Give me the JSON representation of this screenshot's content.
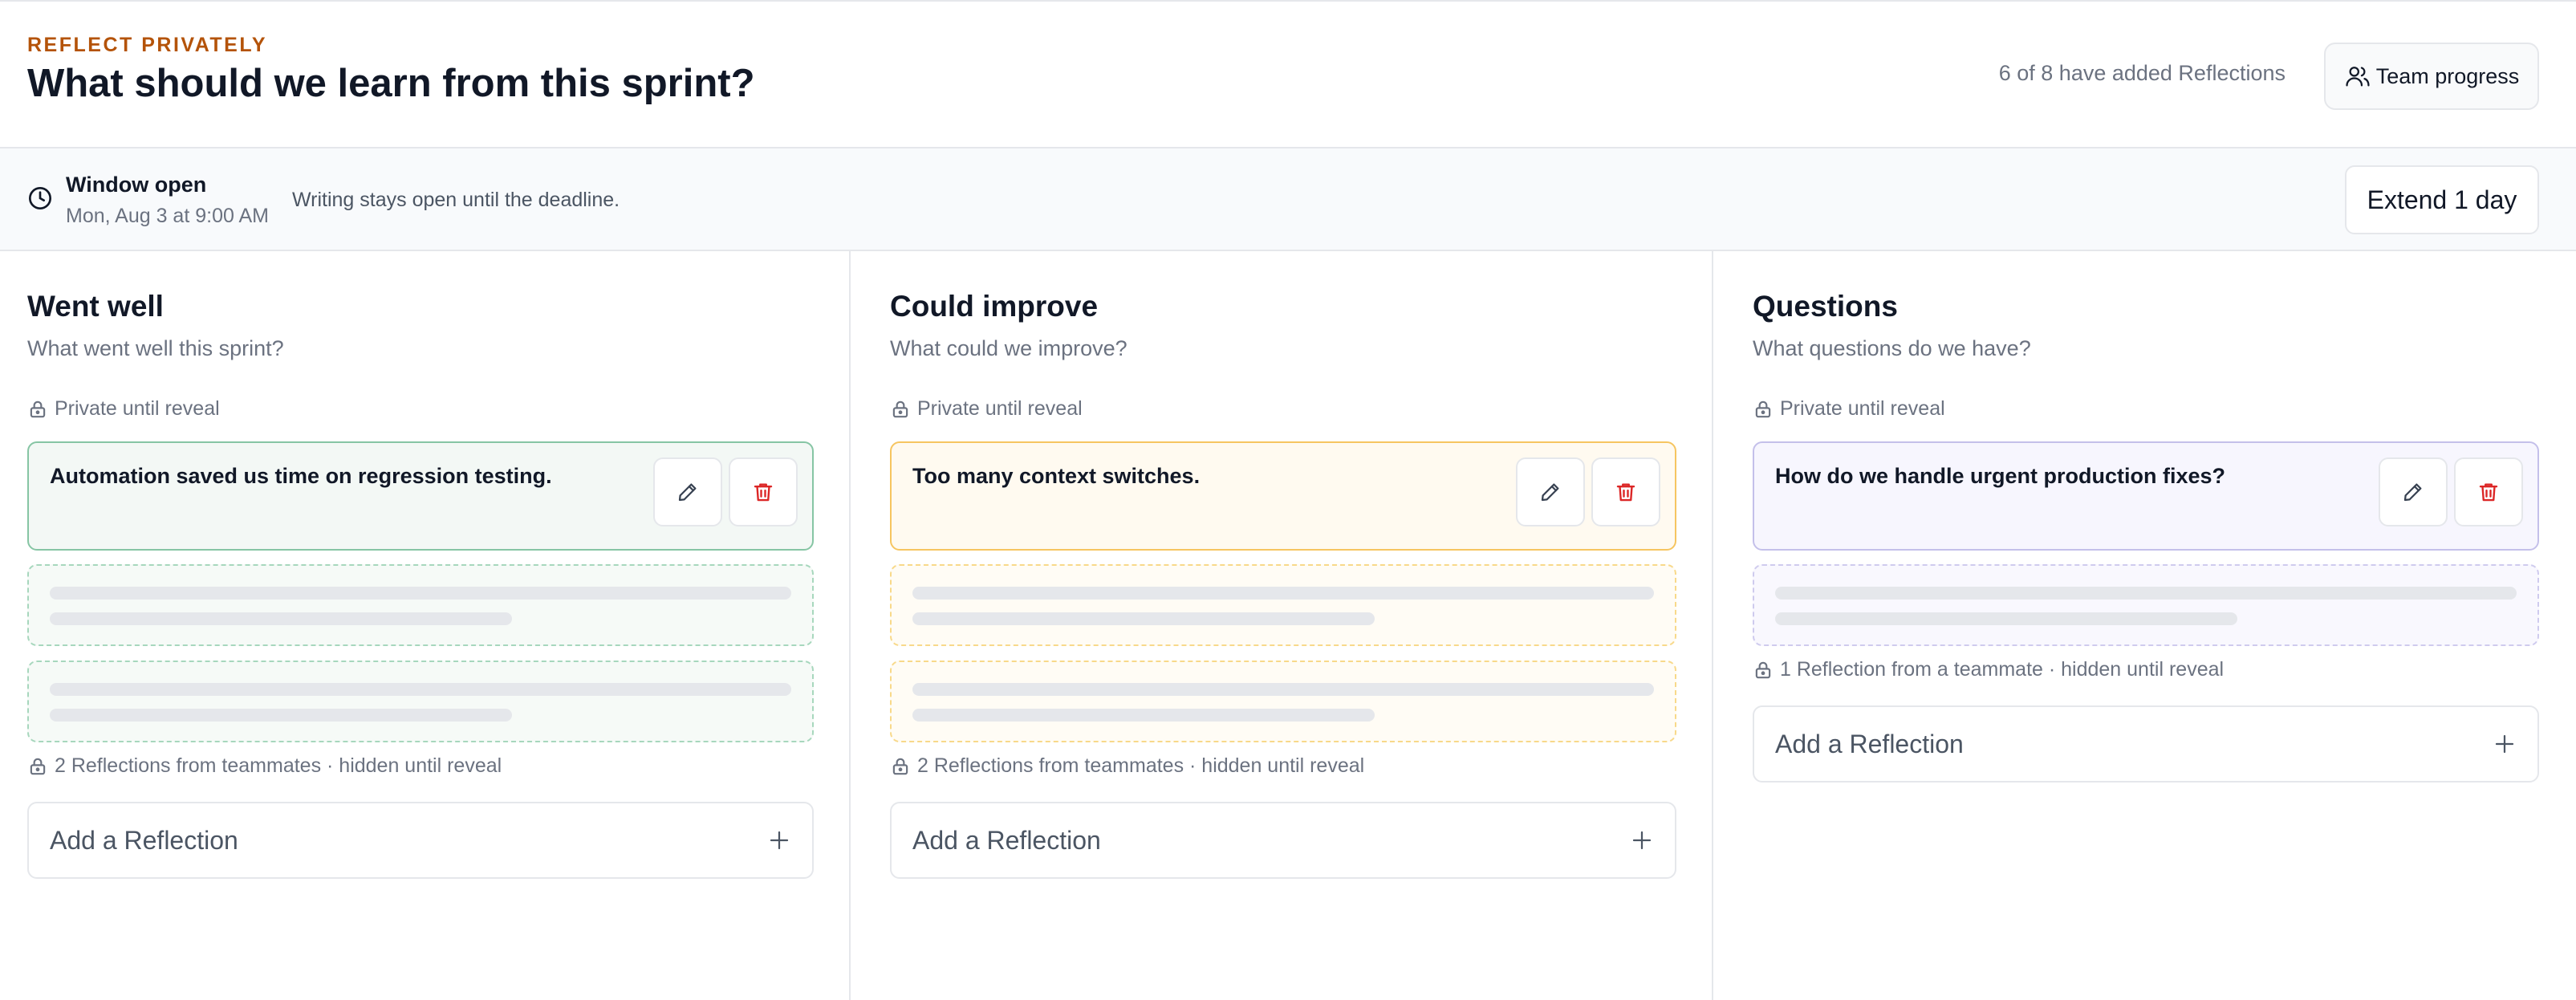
{
  "header": {
    "eyebrow": "REFLECT PRIVATELY",
    "title": "What should we learn from this sprint?",
    "progress": "6 of 8 have added Reflections",
    "team_button": "Team progress"
  },
  "status": {
    "title": "Window open",
    "date": "Mon, Aug 3 at 9:00 AM",
    "note": "Writing stays open until the deadline.",
    "extend_button": "Extend 1 day"
  },
  "columns": [
    {
      "title": "Went well",
      "subtitle": "What went well this sprint?",
      "private_label": "Private until reveal",
      "card_text": "Automation saved us time on regression testing.",
      "hidden_note": "2 Reflections from teammates · hidden until reveal",
      "add_label": "Add a Reflection",
      "colors": {
        "border": "#86c5a4",
        "bg": "#f3f8f5",
        "dash": "#a7d7bd",
        "dash_bg": "#f6faf7"
      }
    },
    {
      "title": "Could improve",
      "subtitle": "What could we improve?",
      "private_label": "Private until reveal",
      "card_text": "Too many context switches.",
      "hidden_note": "2 Reflections from teammates · hidden until reveal",
      "add_label": "Add a Reflection",
      "colors": {
        "border": "#f6c560",
        "bg": "#fffaf0",
        "dash": "#f8d98a",
        "dash_bg": "#fffcf5"
      }
    },
    {
      "title": "Questions",
      "subtitle": "What questions do we have?",
      "private_label": "Private until reveal",
      "card_text": "How do we handle urgent production fixes?",
      "hidden_note": "1 Reflection from a teammate · hidden until reveal",
      "add_label": "Add a Reflection",
      "colors": {
        "border": "#c4c0ea",
        "bg": "#f7f6fe",
        "dash": "#cfcbee",
        "dash_bg": "#f9f8fe"
      }
    }
  ],
  "icons": {
    "team": "users-icon",
    "clock": "clock-icon",
    "lock": "lock-icon",
    "edit": "pencil-icon",
    "delete": "trash-icon",
    "add": "plus-icon"
  },
  "accent": {
    "eyebrow": "#b45309",
    "delete": "#dc2626"
  }
}
